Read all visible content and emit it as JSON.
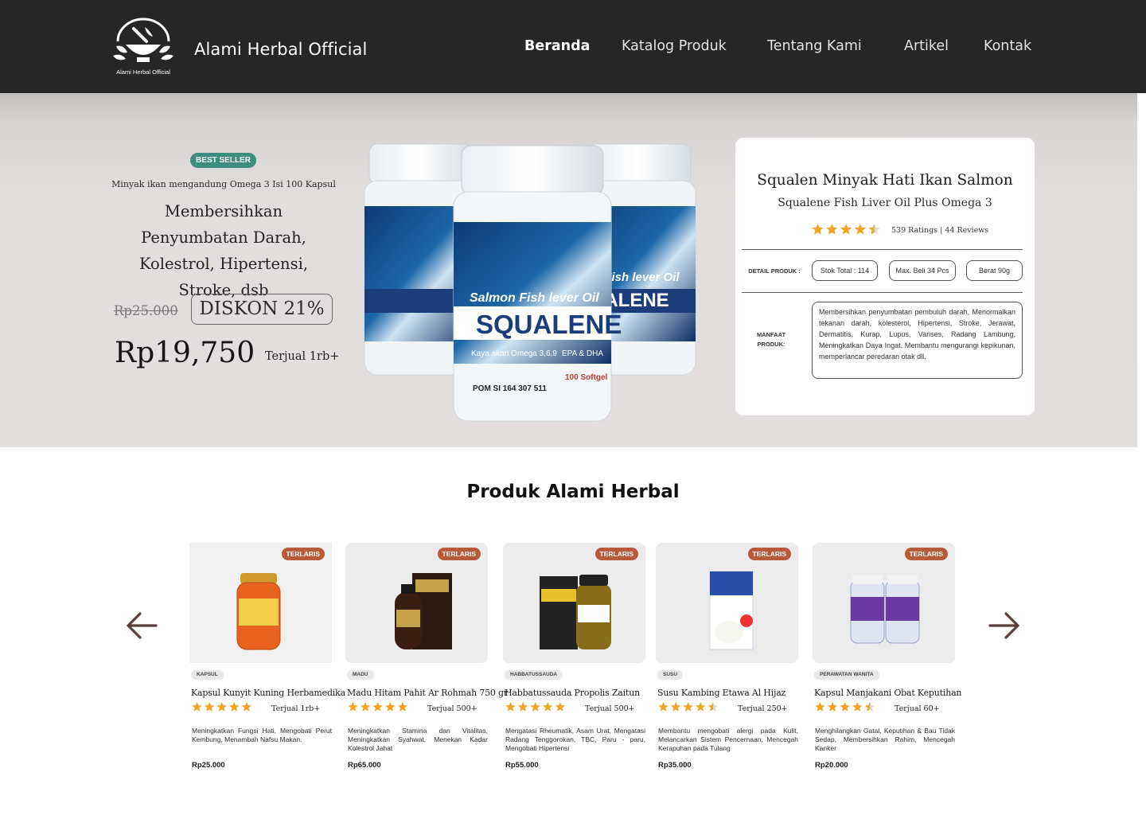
{
  "header": {
    "logo_text": "Alami Herbal Official",
    "brand": "Alami Herbal Official",
    "nav": [
      "Beranda",
      "Katalog Produk",
      "Tentang Kami",
      "Artikel",
      "Kontak"
    ],
    "active_nav": "Beranda"
  },
  "hero": {
    "badge": "BEST SELLER",
    "subtitle": "Minyak ikan mengandung Omega 3 Isi 100 Kapsul",
    "headline": "Membersihkan Penyumbatan Darah, Kolestrol, Hipertensi, Stroke, dsb",
    "old_price": "Rp25.000",
    "discount": "DISKON 21%",
    "price": "Rp19,750",
    "sold": "Terjual 1rb+",
    "jar_label_line1": "Salmon Fish lever Oil",
    "jar_label_line2": "SQUALENE",
    "jar_label_line3": "Kaya akan Omega 3,6,9",
    "jar_label_line4": "EPA & DHA",
    "jar_label_line5": "100 Softgel",
    "jar_label_line6": "POM SI 164 307 511"
  },
  "detail": {
    "title": "Squalen Minyak Hati Ikan Salmon",
    "subtitle": "Squalene Fish Liver Oil Plus Omega 3",
    "rating": 4.5,
    "rating_text": "539 Ratings | 44 Reviews",
    "detail_label": "DETAIL PRODUK :",
    "chips": [
      "Stok Total : 114",
      "Max. Beli 34 Pcs",
      "Berat 90g"
    ],
    "benefit_label": "MANFAAT PRODUK:",
    "benefits": "Membersihkan penyumbatan pembuluh darah, Menormalkan tekanan darah, kolesterol, Hipertensi, Stroke, Jerawat, Dermatitis, Kurap, Lupus, Varises, Radang Lambung, Meningkatkan Daya Ingat, Membantu mengurangi kepikunan, memperlancar peredaran otak dll."
  },
  "products_section": {
    "title": "Produk Alami Herbal",
    "items": [
      {
        "tag": "TERLARIS",
        "category": "KAPSUL",
        "name": "Kapsul Kunyit Kuning Herbamedika",
        "rating": 5,
        "sold": "Terjual 1rb+",
        "desc": "Meningkatkan Fungsi Hati, Mengobati Perut Kembung, Menambah Nafsu Makan.",
        "price": "Rp25.000",
        "image_label": "Kunyit",
        "accent": "#e8621d"
      },
      {
        "tag": "TERLARIS",
        "category": "MADU",
        "name": "Madu Hitam Pahit Ar Rohmah 750 gr",
        "rating": 5,
        "sold": "Terjual 500+",
        "desc": "Meningkatkan Stamina dan Vitalitas, Meningkatkan Syahwat, Menekan Kadar Kolestrol Jahat",
        "price": "Rp65.000",
        "image_label": "Madu",
        "accent": "#3a1e12"
      },
      {
        "tag": "TERLARIS",
        "category": "HABBATUSSAUDA",
        "name": "Habbatussauda Propolis Zaitun",
        "rating": 5,
        "sold": "Terjual 500+",
        "desc": "Mengatasi Rheumatik, Asam Urat, Mengatasi Radang Tenggorokan, TBC, Paru - paru, Mengobati Hipertensi",
        "price": "Rp55.000",
        "image_label": "Habbat",
        "accent": "#232323"
      },
      {
        "tag": "TERLARIS",
        "category": "SUSU",
        "name": "Susu Kambing Etawa Al Hijaz",
        "rating": 4.5,
        "sold": "Terjual 250+",
        "desc": "Membantu mengobati alergi pada Kulit, Melancarkan Sistem Pencernaan, Mencegah Kerapuhan pada Tulang",
        "price": "Rp35.000",
        "image_label": "Al Hijaz",
        "accent": "#2a4fa8"
      },
      {
        "tag": "TERLARIS",
        "category": "PERAWATAN WANITA",
        "name": "Kapsul Manjakani Obat Keputihan",
        "rating": 4.5,
        "sold": "Terjual 60+",
        "desc": "Menghilangkan Gatal, Keputihan & Bau Tidak Sedap, Membersihkan Rahim, Mencegah Kanker",
        "price": "Rp20.000",
        "image_label": "Manjakani",
        "accent": "#6a3aa0"
      }
    ]
  },
  "icons": {
    "logo": "mortar-leaf-logo-icon",
    "prev": "arrow-left-icon",
    "next": "arrow-right-icon",
    "star": "star-icon"
  },
  "colors": {
    "header_bg": "#262626",
    "badge_best_seller": "#3c8c80",
    "tag_terlaris": "#b8593a",
    "star": "#f0a424",
    "arrow": "#5a3e3a"
  }
}
